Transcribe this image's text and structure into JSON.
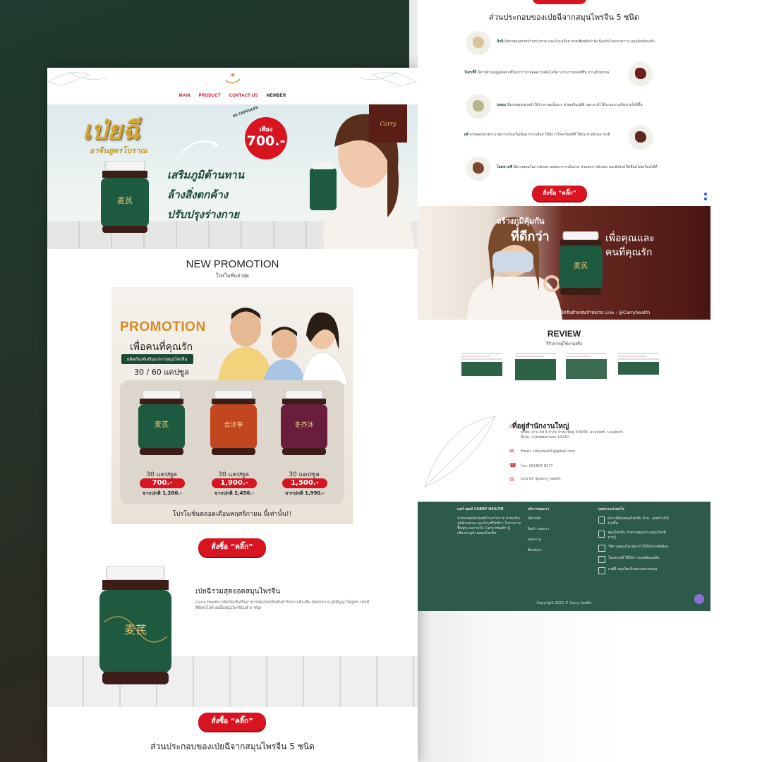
{
  "nav": {
    "main": "MAIN",
    "product": "PRODUCT",
    "contact": "CONTACT US",
    "member": "MEMBER"
  },
  "hero": {
    "title": "เป่ยฉี",
    "subtitle": "ยาจีนสูตรโบราณ",
    "bullets": [
      "เสริมภูมิต้านทาน",
      "ล้างสิ่งตกค้าง",
      "ปรับปรุงร่างกาย"
    ],
    "price_label": "เพียง",
    "price_value": "700.-",
    "capsules": "60 CAPSULES",
    "brand": "Carry"
  },
  "promotion": {
    "title": "NEW PROMOTION",
    "subtitle": "โปรโมชั่นล่าสุด",
    "banner_word": "PROMOTION",
    "banner_love": "เพื่อคนที่คุณรัก",
    "banner_tag": "ผลิตภัณฑ์เสริมอาหารสมุนไพรจีน",
    "banner_caps": "30 / 60 แคปซูล",
    "items": [
      {
        "caps": "30 แคปซูล",
        "price": "700.-",
        "normal": "จากปกติ 1,200.-"
      },
      {
        "caps": "30 แคปซูล",
        "price": "1,900.-",
        "normal": "จากปกติ 2,450.-"
      },
      {
        "caps": "30 แคปซูล",
        "price": "1,500.-",
        "normal": "จากปกติ 1,990.-"
      }
    ],
    "footer": "โปรโมชั่นตลอดเดือนพฤศจิกายน นี้เท่านั้น!!"
  },
  "cta": "สั่งซื้อ “คลิ๊ก”",
  "product": {
    "title": "เป่ยฉีรวมสุดยอดสมุนไพรจีน",
    "desc": "Carry Health ผลิตภัณฑ์เสริมอาหารสมุนไพรจีนต้นตำรับจากเมืองจีน คัดสรรจากภูมิปัญญาได้สูตร 'เป่ยฉี' ที่ยังคงไปด้วยเนื้อสมุนไพรจีนแท้ 5 ชนิด"
  },
  "ingredients_title": "ส่วนประกอบของเป่ยฉีจากสมุนไพรจีน 5 ชนิด",
  "herbs": [
    {
      "name": "ปักฉี",
      "text": "มีสรรพคุณช่วยบำรุงร่างกาย และบำรุงเลือด ช่วยเพิ่มพลังกำลัง ป้องกันโรคเบาหวาน ลดภูมิแพ้ของผิว"
    },
    {
      "name": "โหงวจี้จี้",
      "text": "มีสารต้านอนุมูลอิสระที่ในการฯ ช่วยลดความดันโลหิต ระบบการย่อยดีขึ้น บำรุงผิวพรรณ"
    },
    {
      "name": "เบสอง",
      "text": "มีสรรพคุณช่วยทำให้ร่างกายแข็งแรง ช่วยเสริมภูมิต้านทาน ทำให้ระบบทางเดินหายใจดีขึ้น"
    },
    {
      "name": "ผลี่",
      "text": "สรรพคุณช่วยระบายความร้อนในเลือด บำรุงเลือด ให้มีการไหลเวียนที่ดี ให้ประจำเดือนมาปกติ"
    },
    {
      "name": "โสมซานชี",
      "text": "มีสรรพคุณในการช่วยควบคุมอาการเจ็บปวด ช่วยลดการอักเสบ และยังช่วยให้เลือดไหลเวียนได้ดี"
    }
  ],
  "banner2": {
    "line1": "สร้างภูมิคุ้มกัน",
    "line2": "ที่ดีกว่า",
    "line3a": "เพื่อคุณและ",
    "line3b": "คนที่คุณรัก",
    "contact": "เปิดรับตัวแทนจำหน่าย Line : @Carryhealth"
  },
  "review": {
    "title": "REVIEW",
    "subtitle": "รีวิวจากผู้ใช้งานจริง"
  },
  "office": {
    "title": "ที่อยู่สำนักงานใหญ่",
    "address": "บริษัท เจ้าน ลิฟ จี จำกัด จำกัด ที่อยู่ 308/58, นวลจันทร์, นวลจันทร์, บึงกุ่ม, กรุงเทพมหานคร 10240",
    "email": "Email: carryhealth@gmail.com",
    "phone": "โทร. 061807-8177",
    "line": "Line ID: @carry_health"
  },
  "footer": {
    "col1_title": "แคร์ เฮลท์ CARRY HEALTH",
    "col1_text": "จำหน่ายผลิตภัณฑ์บำรุงร่างกาย ช่วยเสริมภูมิต้านทาน และบำรุงชีวิตชีวา ในร่างกาย ฟื้นฟูระบบภายใน Carry Health ผู้เชี่ยวชาญด้านสมุนไพรจีน",
    "col2_title": "บริการของเรา",
    "col2_items": [
      "หน้าหลัก",
      "สินค้า ของเรา",
      "บทความ",
      "ติดต่อเรา"
    ],
    "col3_title": "บทความน่าสนใจ",
    "col3_items": [
      "อยากมีต้องสมุนไพรจีน ด้วย.. สุขสร้างได้ง่ายขึ้น",
      "สมุนไพรจีน กับสรรพคุณทางสมุนไพรที่ควรรู้",
      "วิธีทานสมุนไพรอย่างไรให้ได้ประสิทธิผล",
      "โสมซานชี ใช้ได้การแพทย์แผนจีน",
      "เบซ์ลี่ สมุนไพรจีนหลายสรรพคุณ"
    ],
    "copyright": "Copyright 2022 © Carry health"
  }
}
